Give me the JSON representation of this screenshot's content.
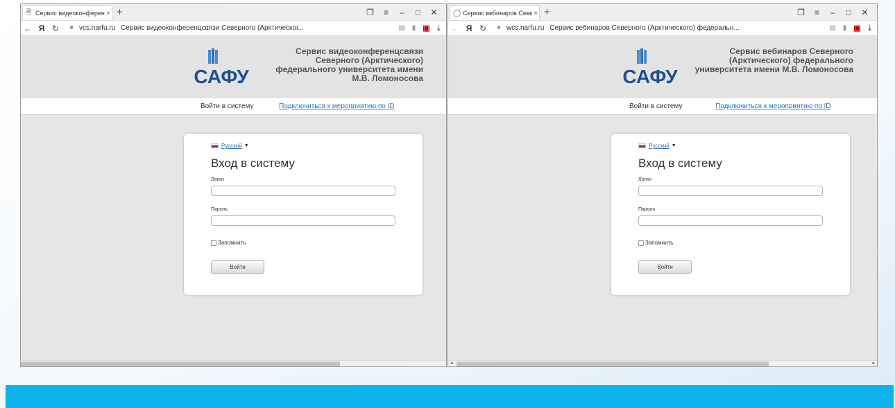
{
  "colors": {
    "slide_band": "#10b2ee",
    "link": "#2f6fb8"
  },
  "left": {
    "tab": {
      "title": "Сервис видеоконферен",
      "icon": "page-icon"
    },
    "address": {
      "domain": "vcs.narfu.ru",
      "page_title": "Сервис видеоконференцсвязи Северного (Арктическог..."
    },
    "header": {
      "logo_text": "САФУ",
      "site_title_lines": [
        "Сервис видеоконференцсвязи",
        "Северного (Арктического)",
        "федерального университета имени",
        "М.В. Ломоносова"
      ]
    },
    "nav": {
      "login": "Войти в систему",
      "connect_id": "Подключиться к мероприятию по ID"
    },
    "form": {
      "language": "Русский",
      "title": "Вход в систему",
      "login_label": "Логин",
      "password_label": "Пароль",
      "remember_label": "Запомнить",
      "submit_label": "Войти"
    }
  },
  "right": {
    "tab": {
      "title": "Сервис вебинаров Севе",
      "icon": "loading-spinner-icon"
    },
    "address": {
      "domain": "wcs.narfu.ru",
      "page_title": "Сервис вебинаров Северного (Арктического) федеральн..."
    },
    "header": {
      "logo_text": "САФУ",
      "site_title_lines": [
        "Сервис вебинаров Северного",
        "(Арктического) федерального",
        "университета имени М.В. Ломоносова"
      ]
    },
    "nav": {
      "login": "Войти в систему",
      "connect_id": "Подключиться к мероприятию по ID"
    },
    "form": {
      "language": "Русский",
      "title": "Вход в систему",
      "login_label": "Логин",
      "password_label": "Пароль",
      "remember_label": "Запомнить",
      "submit_label": "Войти"
    }
  },
  "icons": {
    "back": "arrow-left-icon",
    "yandex": "yandex-icon",
    "reload": "reload-icon",
    "lock": "lock-icon",
    "reader": "reader-mode-icon",
    "bookmark": "bookmark-icon",
    "extension": "extension-icon",
    "download": "download-icon",
    "tabs": "tabs-icon",
    "menu": "menu-icon",
    "minimize": "minimize-icon",
    "maximize": "maximize-icon",
    "close": "close-icon"
  }
}
